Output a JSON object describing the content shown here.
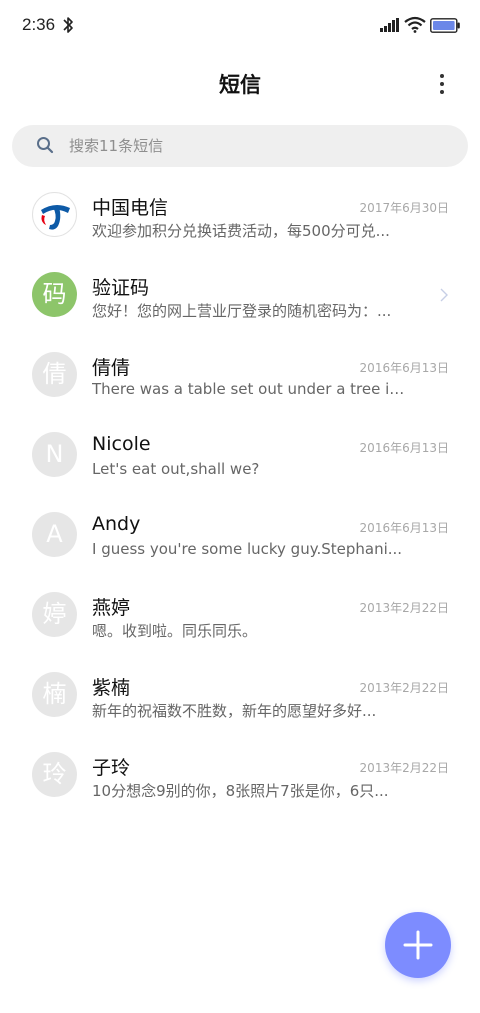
{
  "status_bar": {
    "time": "2:36"
  },
  "header": {
    "title": "短信"
  },
  "search": {
    "placeholder": "搜索11条短信"
  },
  "conversations": [
    {
      "name": "中国电信",
      "preview": "欢迎参加积分兑换话费活动，每500分可兑...",
      "date": "2017年6月30日",
      "avatar": ""
    },
    {
      "name": "验证码",
      "preview": "您好！您的网上营业厅登录的随机密码为：...",
      "date": "",
      "avatar": "码"
    },
    {
      "name": "倩倩",
      "preview": "There was a table set out under a tree in...",
      "date": "2016年6月13日",
      "avatar": "倩"
    },
    {
      "name": "Nicole",
      "preview": "Let's eat out,shall we?",
      "date": "2016年6月13日",
      "avatar": "N"
    },
    {
      "name": "Andy",
      "preview": "I guess you're some lucky guy.Stephani...",
      "date": "2016年6月13日",
      "avatar": "A"
    },
    {
      "name": "燕婷",
      "preview": "嗯。收到啦。同乐同乐。",
      "date": "2013年2月22日",
      "avatar": "婷"
    },
    {
      "name": "紫楠",
      "preview": "新年的祝福数不胜数，新年的愿望好多好...",
      "date": "2013年2月22日",
      "avatar": "楠"
    },
    {
      "name": "子玲",
      "preview": "10分想念9别的你，8张照片7张是你，6只...",
      "date": "2013年2月22日",
      "avatar": "玲"
    }
  ],
  "icons": {
    "bluetooth": "bluetooth-icon",
    "signal": "signal-icon",
    "wifi": "wifi-icon",
    "battery": "battery-icon",
    "more": "more-vertical-icon",
    "search": "search-icon",
    "chevron": "chevron-right-icon",
    "fab": "plus-icon"
  },
  "colors": {
    "accent": "#7d8cff",
    "avatar_default": "#e6e6e6",
    "avatar_green": "#8dc56a",
    "telecom_blue": "#0d5aa7"
  }
}
